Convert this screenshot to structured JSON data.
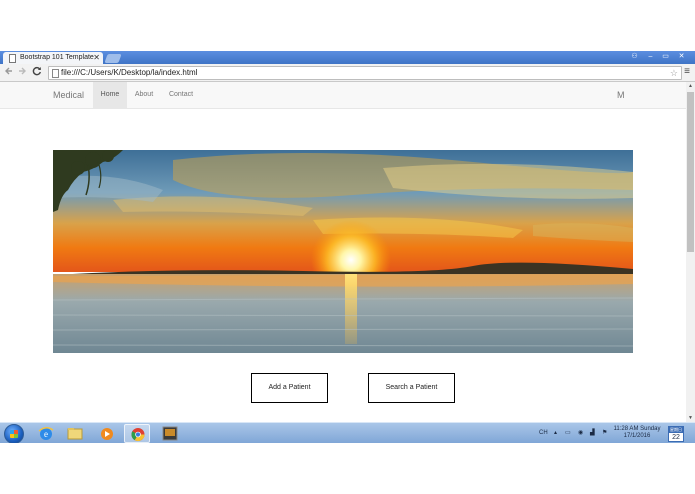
{
  "browser": {
    "tab_title": "Bootstrap 101 Template",
    "tab_close": "✕",
    "url": "file:///C:/Users/K/Desktop/la/index.html",
    "back_icon": "arrow-left-icon",
    "forward_icon": "arrow-right-icon",
    "reload_icon": "reload-icon",
    "bookmark_icon": "star-icon",
    "menu_icon": "menu-icon",
    "window_controls": {
      "profile": "⚇",
      "minimize": "–",
      "maximize": "▭",
      "close": "✕"
    }
  },
  "site": {
    "brand": "Medical",
    "nav": [
      {
        "label": "Home",
        "active": true
      },
      {
        "label": "About",
        "active": false
      },
      {
        "label": "Contact",
        "active": false
      }
    ],
    "nav_right": "M",
    "hero_image": "sunset-over-lake",
    "buttons": {
      "add_patient": "Add a Patient",
      "search_patient": "Search a Patient"
    }
  },
  "taskbar": {
    "pinned": [
      "internet-explorer-icon",
      "file-explorer-icon",
      "media-player-icon",
      "chrome-icon",
      "app-icon"
    ],
    "active_app": "chrome-icon",
    "language": "CH",
    "tray_icons": [
      "arrow-up-icon",
      "network-icon",
      "volume-icon",
      "signal-icon",
      "flag-icon"
    ],
    "time": "11:28 AM Sunday",
    "date": "17/1/2016",
    "calendar_top": "星期日",
    "calendar_day": "22"
  },
  "colors": {
    "chrome_frame": "#4a7fd0",
    "navbar_bg": "#f8f8f8",
    "active_nav_bg": "#e7e7e7",
    "taskbar": "#8fb3df"
  }
}
